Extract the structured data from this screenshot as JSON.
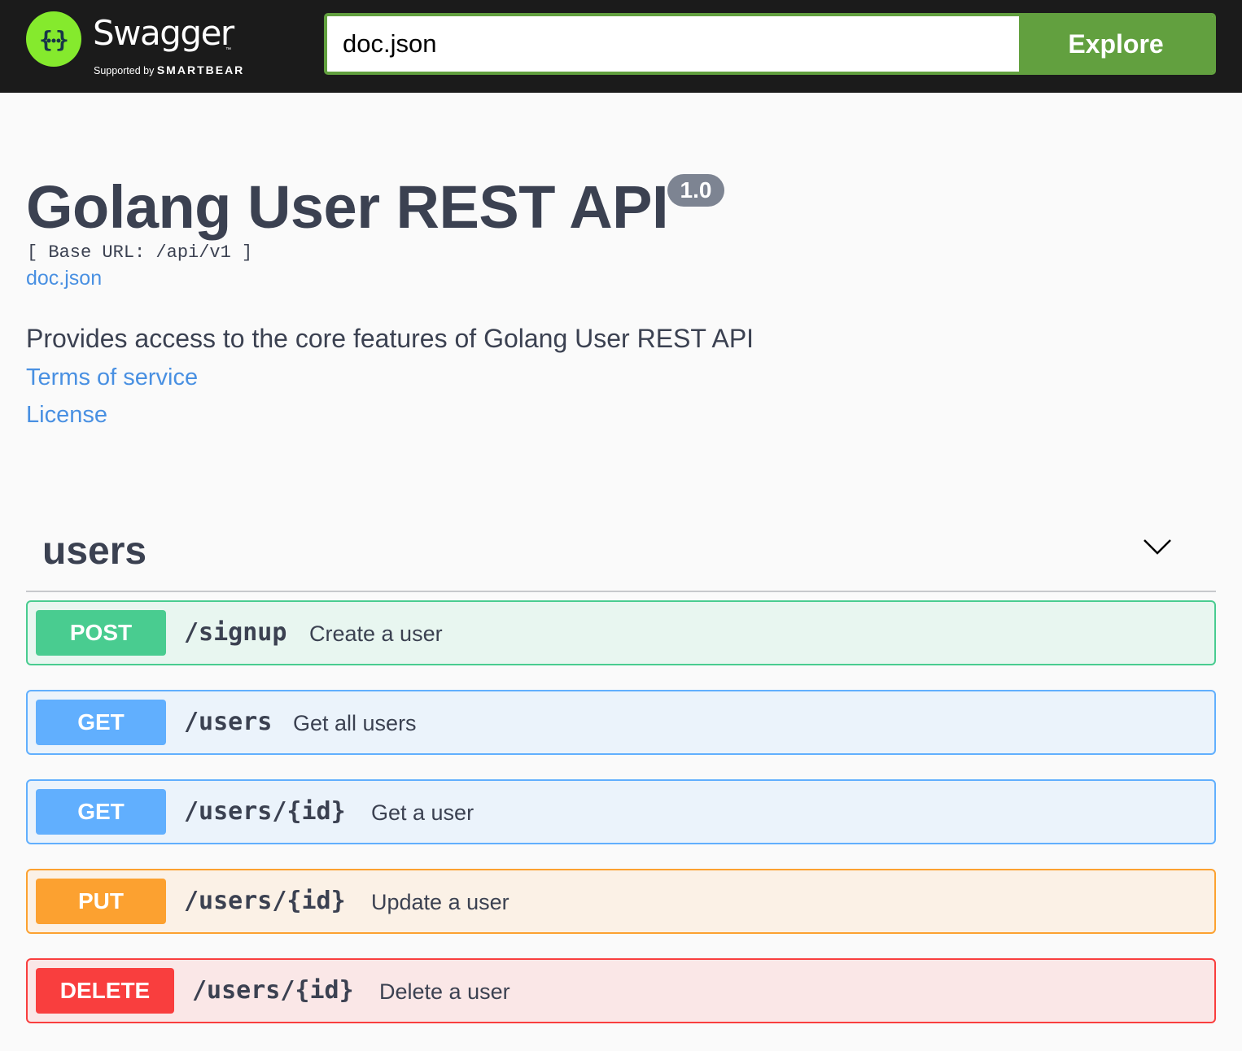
{
  "topbar": {
    "brand_name": "Swagger",
    "brand_tm": "™",
    "supported_by": "Supported by",
    "supporter": "SMARTBEAR",
    "url_value": "doc.json",
    "explore_label": "Explore",
    "accent_color": "#62a03f",
    "logo_color": "#85ea2d",
    "logo_icon": "curly-braces-icon"
  },
  "info": {
    "title": "Golang User REST API",
    "version": "1.0",
    "base_url": "[ Base URL: /api/v1 ]",
    "spec_link": "doc.json",
    "description": "Provides access to the core features of Golang User REST API",
    "terms_label": "Terms of service",
    "license_label": "License"
  },
  "tags": [
    {
      "name": "users",
      "expanded": true,
      "operations": [
        {
          "method": "POST",
          "path": "/signup",
          "summary": "Create a user",
          "color": "#49cc90"
        },
        {
          "method": "GET",
          "path": "/users",
          "summary": "Get all users",
          "color": "#61affe"
        },
        {
          "method": "GET",
          "path": "/users/{id}",
          "summary": "Get a user",
          "color": "#61affe"
        },
        {
          "method": "PUT",
          "path": "/users/{id}",
          "summary": "Update a user",
          "color": "#fca130"
        },
        {
          "method": "DELETE",
          "path": "/users/{id}",
          "summary": "Delete a user",
          "color": "#f93e3e"
        }
      ]
    }
  ]
}
